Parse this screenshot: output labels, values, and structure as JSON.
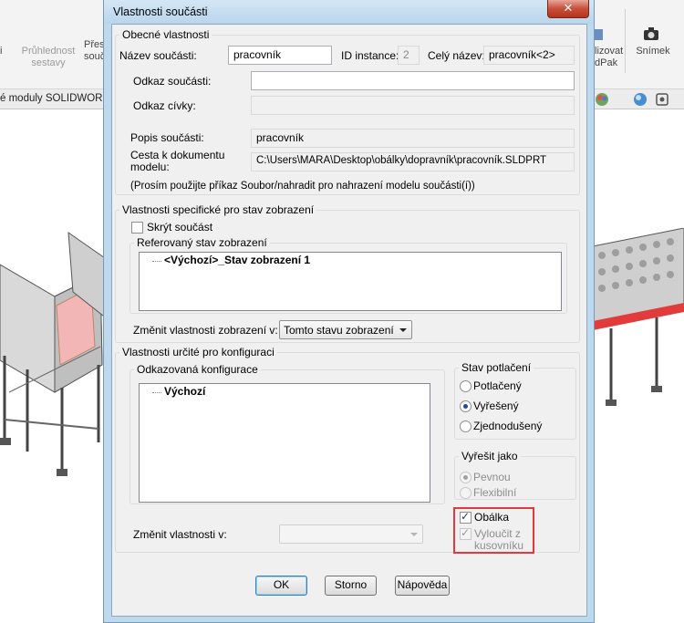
{
  "background": {
    "ribbon": {
      "transparency_label": "Průhlednost sestavy",
      "move_label": "Přesu souč",
      "vizualizovat_label": "lizovat dPak",
      "snapshot_label": "Snímek",
      "left_letter": "i"
    },
    "tab_strip": {
      "label": "é moduly SOLIDWORKS"
    }
  },
  "dialog": {
    "title": "Vlastnosti součásti",
    "close_glyph": "✕",
    "general": {
      "legend": "Obecné vlastnosti",
      "name_label": "Název součásti:",
      "name_value": "pracovník",
      "instance_label": "ID instance:",
      "instance_value": "2",
      "fullname_label": "Celý název:",
      "fullname_value": "pracovník<2>",
      "reference_label": "Odkaz součásti:",
      "reference_value": "",
      "coil_label": "Odkaz cívky:",
      "coil_value": "",
      "description_label": "Popis součásti:",
      "description_value": "pracovník",
      "path_label_1": "Cesta k dokumentu",
      "path_label_2": "modelu:",
      "path_value": "C:\\Users\\MARA\\Desktop\\obálky\\dopravník\\pracovník.SLDPRT",
      "note": "(Prosím použijte příkaz Soubor/nahradit pro nahrazení modelu součásti(í))"
    },
    "display": {
      "legend": "Vlastnosti specifické pro stav zobrazení",
      "hide_label": "Skrýt součást",
      "hide_checked": false,
      "ref_legend": "Referovaný stav zobrazení",
      "ref_item": "<Výchozí>_Stav zobrazení 1",
      "change_label": "Změnit vlastnosti zobrazení v:",
      "change_value": "Tomto stavu zobrazení"
    },
    "config": {
      "legend": "Vlastnosti určité pro konfiguraci",
      "ref_legend": "Odkazovaná konfigurace",
      "ref_item": "Výchozí",
      "change_label": "Změnit vlastnosti v:",
      "change_value": "",
      "suppression": {
        "legend": "Stav potlačení",
        "options": [
          "Potlačený",
          "Vyřešený",
          "Zjednodušený"
        ],
        "selected": "Vyřešený"
      },
      "solve_as": {
        "legend": "Vyřešit jako",
        "options": [
          "Pevnou",
          "Flexibilní"
        ],
        "selected": "Pevnou"
      },
      "envelope_label": "Obálka",
      "envelope_checked": true,
      "exclude_label_1": "Vyloučit z",
      "exclude_label_2": "kusovníku",
      "exclude_checked": true
    },
    "buttons": {
      "ok": "OK",
      "cancel": "Storno",
      "help": "Nápověda"
    },
    "highlight_color": "#e0393e"
  }
}
